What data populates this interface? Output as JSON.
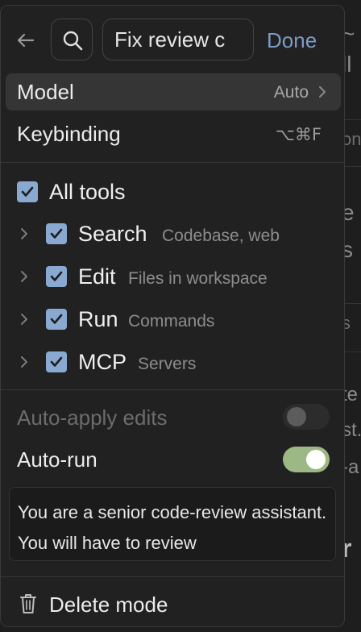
{
  "header": {
    "name_value": "Fix review c",
    "done_label": "Done"
  },
  "settings": {
    "model_label": "Model",
    "model_value": "Auto",
    "keybinding_label": "Keybinding",
    "keybinding_value": "⌥⌘F"
  },
  "tools": {
    "all_label": "All tools",
    "all_checked": true,
    "items": [
      {
        "name": "Search",
        "description": "Codebase, web",
        "checked": true
      },
      {
        "name": "Edit",
        "description": "Files in workspace",
        "checked": true
      },
      {
        "name": "Run",
        "description": "Commands",
        "checked": true
      },
      {
        "name": "MCP",
        "description": "Servers",
        "checked": true
      }
    ]
  },
  "options": {
    "auto_apply_label": "Auto-apply edits",
    "auto_apply_enabled": false,
    "auto_run_label": "Auto-run",
    "auto_run_enabled": true
  },
  "prompt": {
    "text": "You are a senior code-review assistant. You will have to review"
  },
  "delete_label": "Delete mode",
  "background_fragments": [
    "~",
    "ll",
    "on",
    "e",
    "s",
    "s",
    "te",
    "st.",
    "-a",
    "r"
  ],
  "colors": {
    "accent": "#7d9bc8",
    "checkbox": "#8aa9d1",
    "toggle_on": "#9cb884",
    "panel_bg": "#212121"
  }
}
